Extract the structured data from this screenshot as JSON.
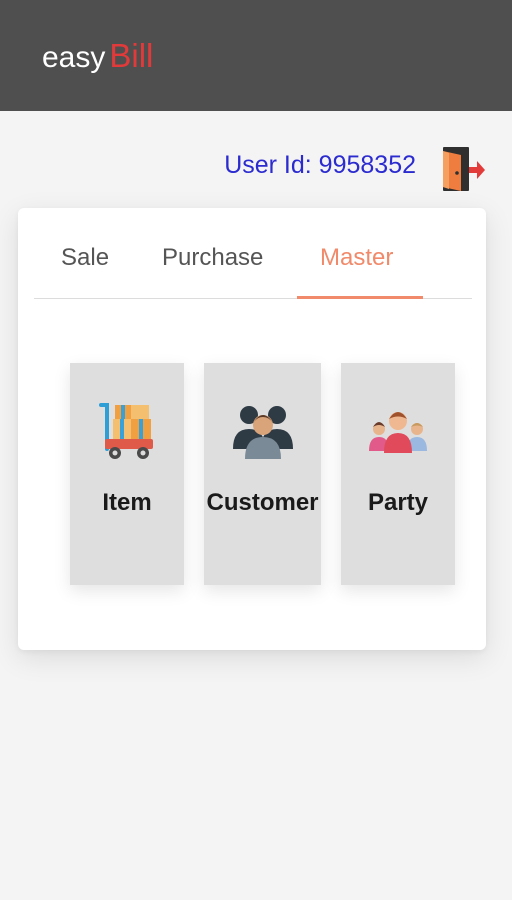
{
  "header": {
    "brand_part1": "easy",
    "brand_part2": "Bill"
  },
  "user": {
    "id_text": "User Id: 9958352"
  },
  "tabs": [
    {
      "label": "Sale"
    },
    {
      "label": "Purchase"
    },
    {
      "label": "Master",
      "active": true
    }
  ],
  "tiles": [
    {
      "label": "Item",
      "icon": "cart-boxes-icon"
    },
    {
      "label": "Customer",
      "icon": "customer-group-icon"
    },
    {
      "label": "Party",
      "icon": "party-people-icon"
    }
  ],
  "colors": {
    "topbar": "#4f4f4f",
    "brand_accent": "#e23a3a",
    "user_id": "#2b2bd0",
    "active_tab": "#f08a6a",
    "tile_bg": "#dedede"
  },
  "icons": {
    "logout": "logout-door-icon"
  }
}
